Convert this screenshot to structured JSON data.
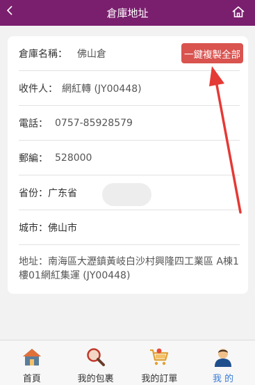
{
  "header": {
    "title": "倉庫地址",
    "back_icon": "chevron-left-icon",
    "home_icon": "home-icon"
  },
  "warehouse": {
    "name_label": "倉庫名稱：",
    "name_value": "佛山倉",
    "copy_all_label": "一鍵複製全部",
    "recipient_label": "收件人：",
    "recipient_value": "網紅轉 (JY00448)",
    "phone_label": "電話：",
    "phone_value": "0757-85928579",
    "postcode_label": "郵編：",
    "postcode_value": "528000",
    "province_label": "省份：",
    "province_value": "广东省",
    "city_label": "城市：",
    "city_value": "佛山市",
    "address_label": "地址：",
    "address_value": "南海區大瀝鎮黃岐白沙村興隆四工業區 A棟1樓01網紅集運 (JY00448)"
  },
  "colors": {
    "header": "#7a1f6e",
    "copy_button": "#d9534f",
    "arrow": "#e53935",
    "active_tab": "#3a7bd5"
  },
  "tabbar": {
    "items": [
      {
        "label": "首頁",
        "icon": "house-icon"
      },
      {
        "label": "我的包裹",
        "icon": "magnifier-icon"
      },
      {
        "label": "我的訂單",
        "icon": "cart-icon"
      },
      {
        "label": "我 的",
        "icon": "user-icon",
        "active": true
      }
    ]
  }
}
